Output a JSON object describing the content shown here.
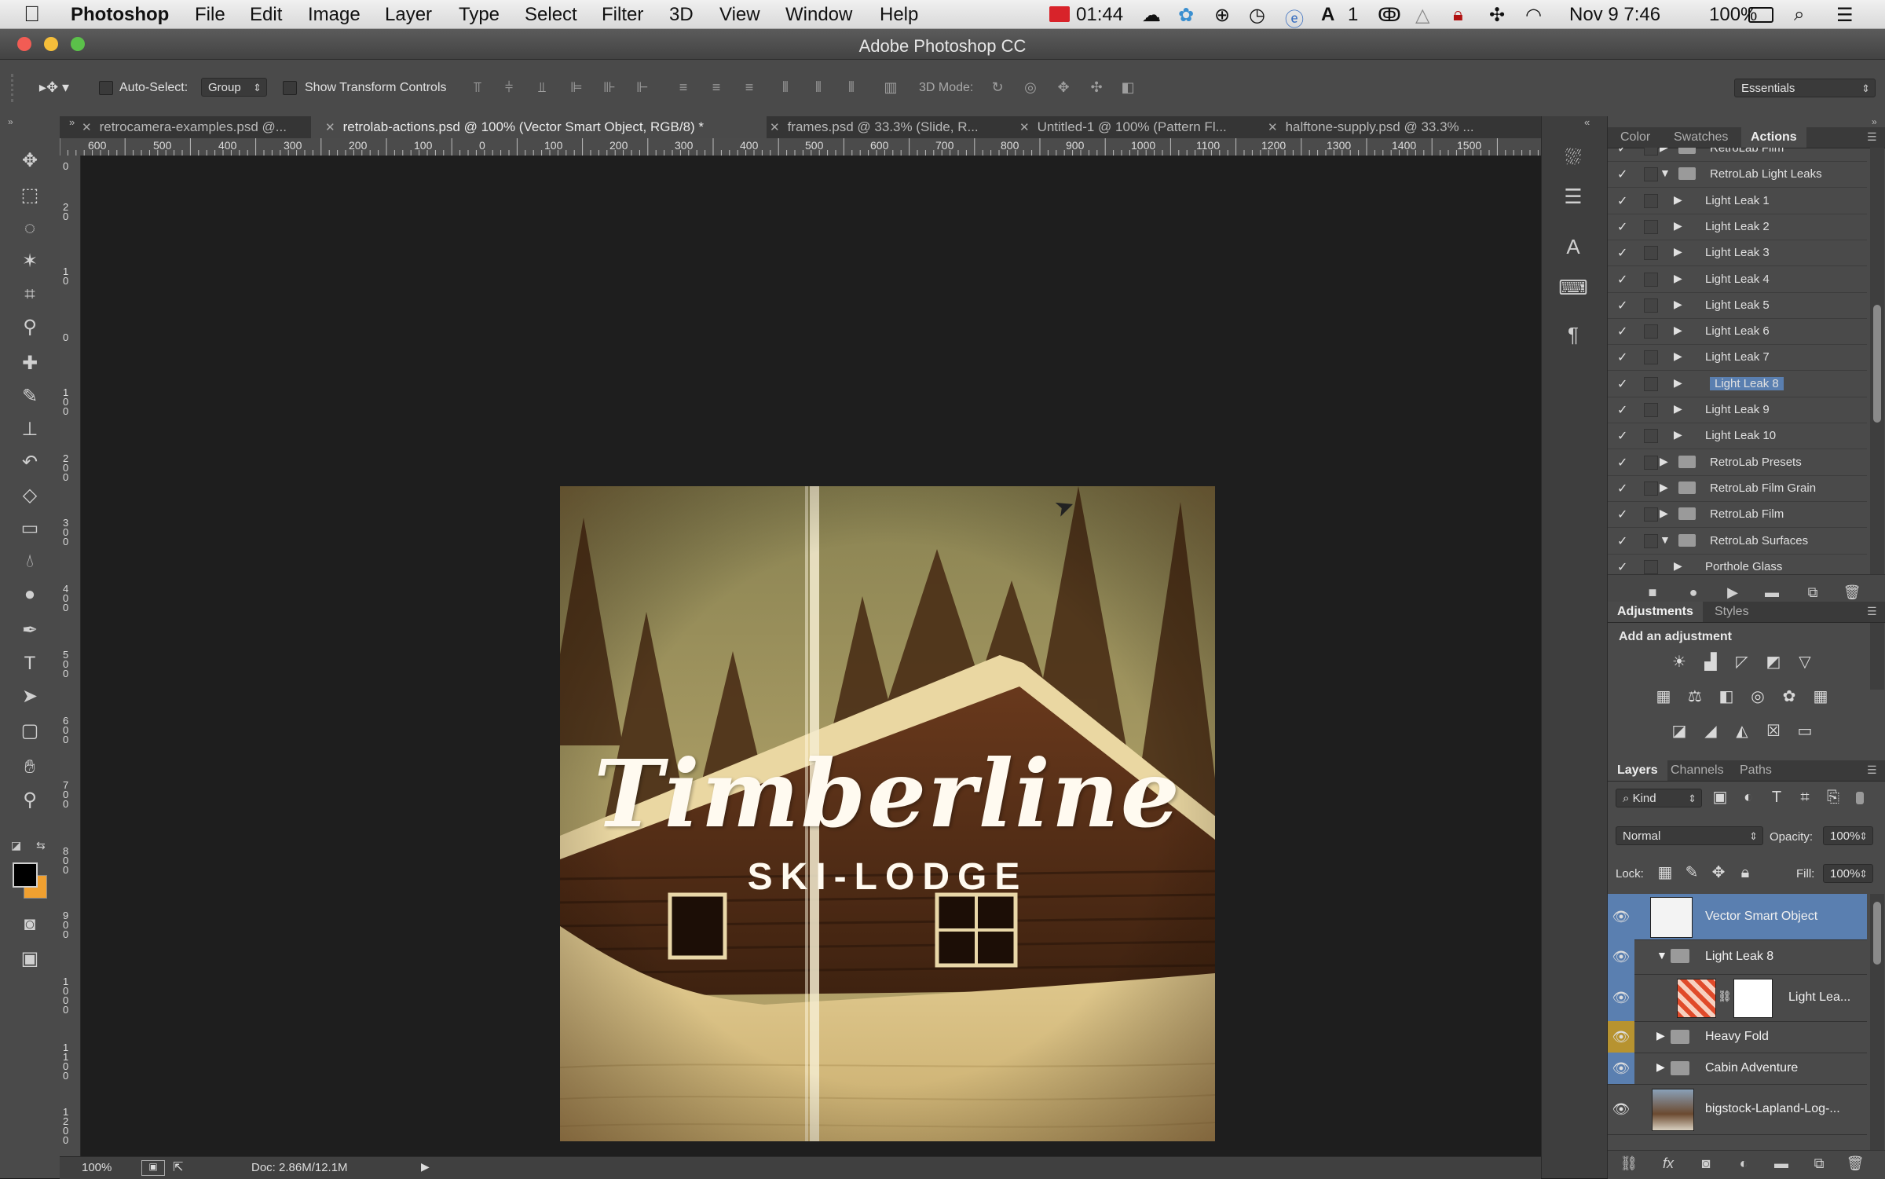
{
  "menubar": {
    "app": "Photoshop",
    "items": [
      "File",
      "Edit",
      "Image",
      "Layer",
      "Type",
      "Select",
      "Filter",
      "3D",
      "View",
      "Window",
      "Help"
    ],
    "status": {
      "battery_timer": "01:44",
      "badge_count": "1",
      "date_time": "Nov 9  7:46",
      "battery": "100%"
    }
  },
  "window": {
    "title": "Adobe Photoshop CC"
  },
  "options": {
    "auto_select_label": "Auto-Select:",
    "auto_select_value": "Group",
    "transform_label": "Show Transform Controls",
    "mode_label": "3D Mode:",
    "workspace": "Essentials"
  },
  "tabs": [
    {
      "label": "retrocamera-examples.psd @..."
    },
    {
      "label": "retrolab-actions.psd @ 100% (Vector Smart Object, RGB/8) *",
      "active": true
    },
    {
      "label": "frames.psd @ 33.3% (Slide, R..."
    },
    {
      "label": "Untitled-1 @ 100% (Pattern Fl..."
    },
    {
      "label": "halftone-supply.psd @ 33.3% ..."
    }
  ],
  "ruler": {
    "h": [
      "600",
      "500",
      "400",
      "300",
      "200",
      "100",
      "0",
      "100",
      "200",
      "300",
      "400",
      "500",
      "600",
      "700",
      "800",
      "900",
      "1000",
      "1100",
      "1200",
      "1300",
      "1400",
      "1500"
    ],
    "v": [
      "0",
      "2 0",
      "1 0",
      "0",
      "1 0 0",
      "2 0 0",
      "3 0 0",
      "4 0 0",
      "5 0 0",
      "6 0 0",
      "7 0 0",
      "8 0 0",
      "9 0 0",
      "1 0 0 0",
      "1 1 0 0",
      "1 2 0 0"
    ]
  },
  "artwork": {
    "title": "Timberline",
    "subtitle": "SKI-LODGE"
  },
  "status": {
    "zoom": "100%",
    "doc": "Doc: 2.86M/12.1M"
  },
  "actions_panel": {
    "tabs": [
      "Color",
      "Swatches",
      "Actions"
    ],
    "rows": [
      {
        "label": "RetroLab Film",
        "type": "set",
        "open": false,
        "indent": 1
      },
      {
        "label": "RetroLab Light Leaks",
        "type": "set",
        "open": true,
        "indent": 1
      },
      {
        "label": "Light Leak 1",
        "type": "action",
        "indent": 2
      },
      {
        "label": "Light Leak 2",
        "type": "action",
        "indent": 2
      },
      {
        "label": "Light Leak 3",
        "type": "action",
        "indent": 2
      },
      {
        "label": "Light Leak 4",
        "type": "action",
        "indent": 2
      },
      {
        "label": "Light Leak 5",
        "type": "action",
        "indent": 2
      },
      {
        "label": "Light Leak 6",
        "type": "action",
        "indent": 2
      },
      {
        "label": "Light Leak 7",
        "type": "action",
        "indent": 2
      },
      {
        "label": "Light Leak 8",
        "type": "action",
        "indent": 2,
        "selected": true
      },
      {
        "label": "Light Leak 9",
        "type": "action",
        "indent": 2
      },
      {
        "label": "Light Leak 10",
        "type": "action",
        "indent": 2
      },
      {
        "label": "RetroLab Presets",
        "type": "set",
        "open": false,
        "indent": 1
      },
      {
        "label": "RetroLab Film Grain",
        "type": "set",
        "open": false,
        "indent": 1
      },
      {
        "label": "RetroLab Film",
        "type": "set",
        "open": false,
        "indent": 1
      },
      {
        "label": "RetroLab Surfaces",
        "type": "set",
        "open": true,
        "indent": 1
      },
      {
        "label": "Porthole Glass",
        "type": "action",
        "indent": 2
      }
    ]
  },
  "adjustments_panel": {
    "tabs": [
      "Adjustments",
      "Styles"
    ],
    "heading": "Add an adjustment"
  },
  "layers_panel": {
    "tabs": [
      "Layers",
      "Channels",
      "Paths"
    ],
    "filter": "Kind",
    "blend_mode": "Normal",
    "opacity_label": "Opacity:",
    "opacity": "100%",
    "lock_label": "Lock:",
    "fill_label": "Fill:",
    "fill": "100%",
    "layers": [
      {
        "name": "Vector Smart Object",
        "selected": true
      },
      {
        "name": "Light Leak 8",
        "group": true
      },
      {
        "name": "Light Lea..."
      },
      {
        "name": "Heavy Fold",
        "group": true
      },
      {
        "name": "Cabin Adventure",
        "group": true
      },
      {
        "name": "bigstock-Lapland-Log-..."
      }
    ]
  },
  "colors": {
    "accent": "#5a7fb0",
    "fg_swatch": "#000000",
    "bg_swatch": "#f0a030"
  }
}
